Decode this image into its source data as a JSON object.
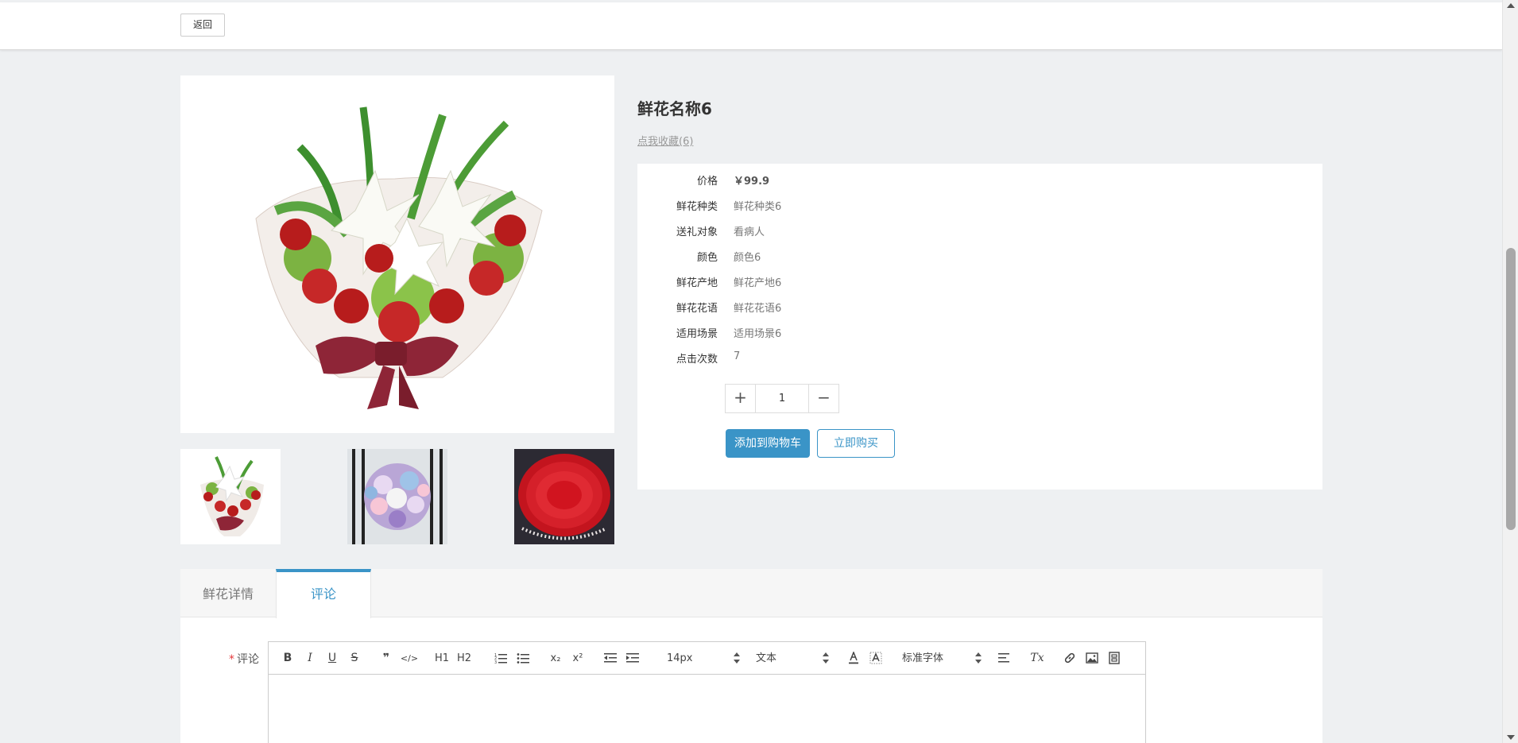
{
  "header": {
    "back_label": "返回"
  },
  "product": {
    "title": "鲜花名称6",
    "favorite_link": "点我收藏(6)",
    "attributes": [
      {
        "label": "价格",
        "value": "￥99.9"
      },
      {
        "label": "鲜花种类",
        "value": "鲜花种类6"
      },
      {
        "label": "送礼对象",
        "value": "看病人"
      },
      {
        "label": "颜色",
        "value": "颜色6"
      },
      {
        "label": "鲜花产地",
        "value": "鲜花产地6"
      },
      {
        "label": "鲜花花语",
        "value": "鲜花花语6"
      },
      {
        "label": "适用场景",
        "value": "适用场景6"
      },
      {
        "label": "点击次数",
        "value": "7"
      }
    ],
    "quantity": {
      "plus": "+",
      "value": "1",
      "minus": "−"
    },
    "add_to_cart_label": "添加到购物车",
    "buy_now_label": "立即购买"
  },
  "tabs": [
    {
      "label": "鲜花详情",
      "active": false
    },
    {
      "label": "评论",
      "active": true
    }
  ],
  "comment_form": {
    "label": "评论",
    "required_mark": "*",
    "toolbar": {
      "bold": "B",
      "italic": "I",
      "underline": "U",
      "strike": "S",
      "blockquote": "❞",
      "code": "</>",
      "h1": "H1",
      "h2": "H2",
      "subscript": "x₂",
      "superscript": "x²",
      "size_select": "14px",
      "header_select": "文本",
      "font_select": "标准字体",
      "clear": "Tx"
    }
  },
  "colors": {
    "accent": "#3a94c7",
    "page_bg": "#eef0f2",
    "required": "#e4393c"
  },
  "icons": {
    "ordered_list": "ordered-list-icon",
    "bullet_list": "bullet-list-icon",
    "outdent": "outdent-icon",
    "indent": "indent-icon",
    "font_color": "font-color-icon",
    "background_color": "background-color-icon",
    "align": "align-icon",
    "link": "link-icon",
    "image": "image-icon",
    "video": "video-icon"
  }
}
